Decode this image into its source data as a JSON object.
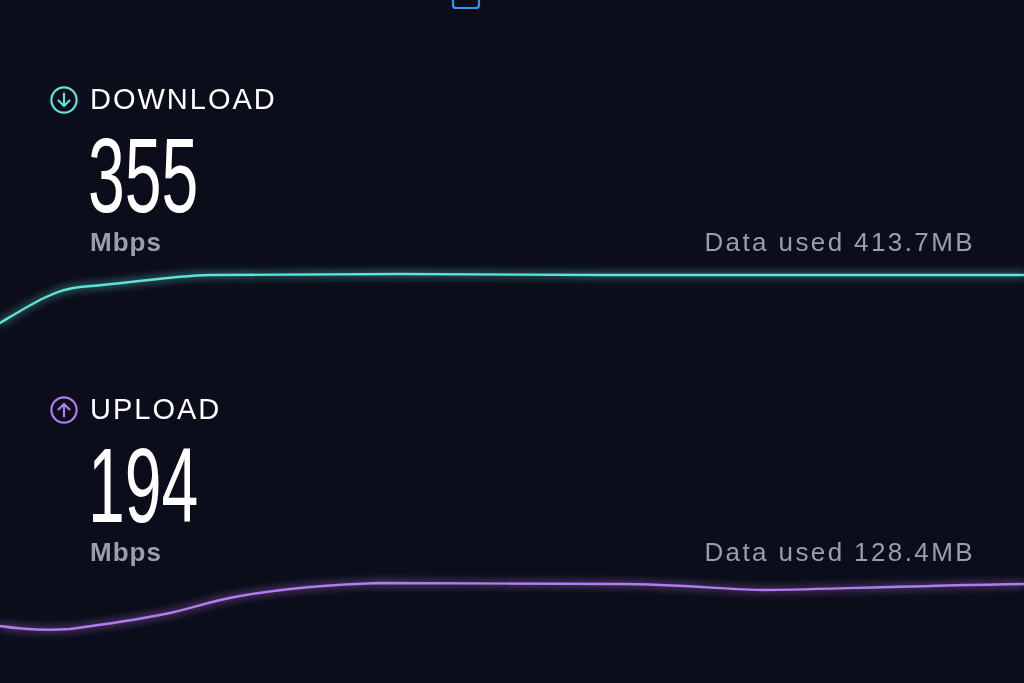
{
  "metrics": [
    {
      "kind": "download",
      "label": "DOWNLOAD",
      "value": "355",
      "unit": "Mbps",
      "data_used": "Data used 413.7MB",
      "color": "#5fe3d6"
    },
    {
      "kind": "upload",
      "label": "UPLOAD",
      "value": "194",
      "unit": "Mbps",
      "data_used": "Data used 128.4MB",
      "color": "#b27cec"
    }
  ]
}
